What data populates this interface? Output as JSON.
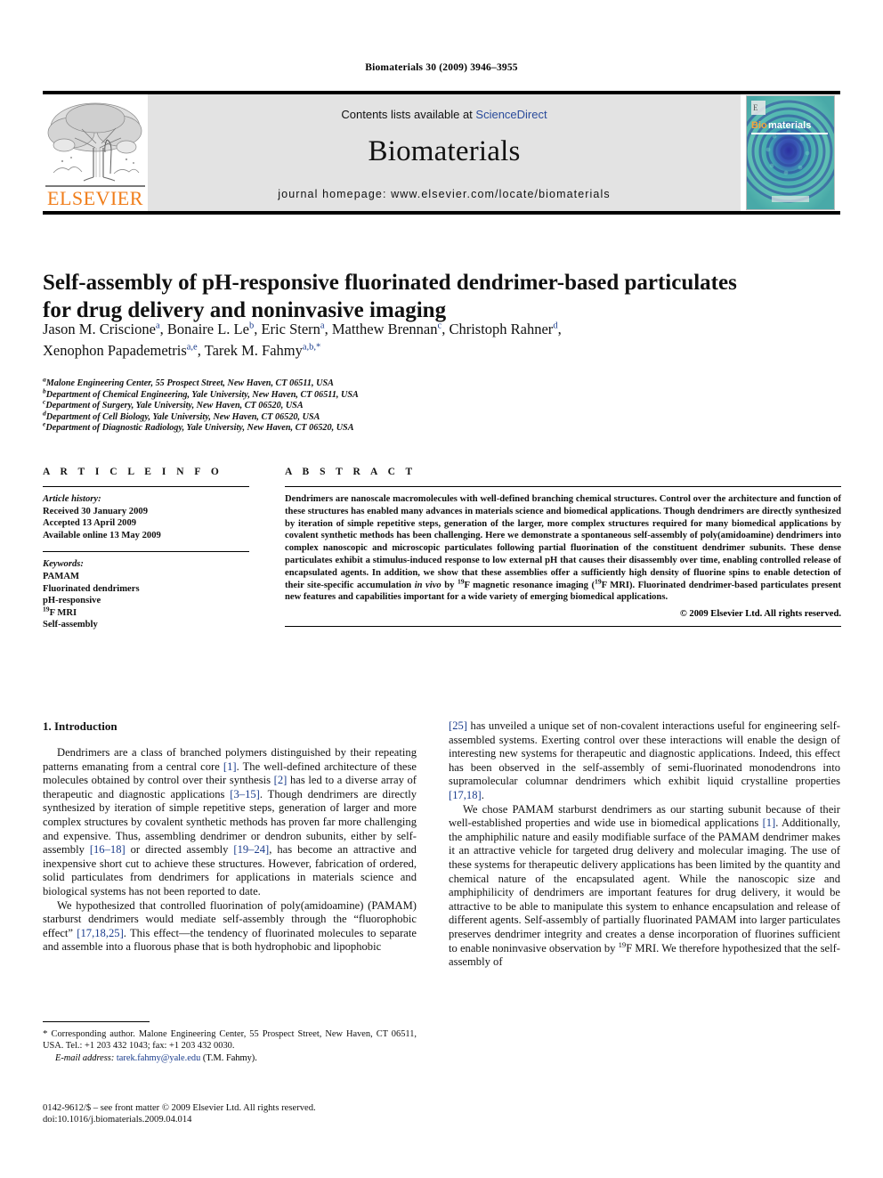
{
  "running_head": "Biomaterials 30 (2009) 3946–3955",
  "masthead": {
    "publisher_name": "ELSEVIER",
    "contents_prefix": "Contents lists available at ",
    "contents_link": "ScienceDirect",
    "journal_title": "Biomaterials",
    "homepage": "journal homepage: www.elsevier.com/locate/biomaterials",
    "cover_label": "Biomaterials",
    "link_color": "#2a4b9b",
    "brand_color": "#f07d1a",
    "band_color": "#e3e3e3"
  },
  "article": {
    "title_line1": "Self-assembly of pH-responsive fluorinated dendrimer-based particulates",
    "title_line2": "for drug delivery and noninvasive imaging",
    "authors": [
      {
        "name": "Jason M. Criscione",
        "sup": "a",
        "sep": ", "
      },
      {
        "name": "Bonaire L. Le",
        "sup": "b",
        "sep": ", "
      },
      {
        "name": "Eric Stern",
        "sup": "a",
        "sep": ", "
      },
      {
        "name": "Matthew Brennan",
        "sup": "c",
        "sep": ", "
      },
      {
        "name": "Christoph Rahner",
        "sup": "d",
        "sep": ","
      },
      {
        "name": "Xenophon Papademetris",
        "sup": "a,e",
        "sep": ", "
      },
      {
        "name": "Tarek M. Fahmy",
        "sup": "a,b,*",
        "sep": ""
      }
    ],
    "affiliations": [
      {
        "mark": "a",
        "text": "Malone Engineering Center, 55 Prospect Street, New Haven, CT 06511, USA"
      },
      {
        "mark": "b",
        "text": "Department of Chemical Engineering, Yale University, New Haven, CT 06511, USA"
      },
      {
        "mark": "c",
        "text": "Department of Surgery, Yale University, New Haven, CT 06520, USA"
      },
      {
        "mark": "d",
        "text": "Department of Cell Biology, Yale University, New Haven, CT 06520, USA"
      },
      {
        "mark": "e",
        "text": "Department of Diagnostic Radiology, Yale University, New Haven, CT 06520, USA"
      }
    ]
  },
  "article_info": {
    "heading": "A R T I C L E  I N F O",
    "history_label": "Article history:",
    "history": [
      "Received 30 January 2009",
      "Accepted 13 April 2009",
      "Available online 13 May 2009"
    ],
    "keywords_label": "Keywords:",
    "keywords": [
      "PAMAM",
      "Fluorinated dendrimers",
      "pH-responsive",
      "19F MRI",
      "Self-assembly"
    ]
  },
  "abstract": {
    "heading": "A B S T R A C T",
    "paragraph_part1": "Dendrimers are nanoscale macromolecules with well-defined branching chemical structures. Control over the architecture and function of these structures has enabled many advances in materials science and biomedical applications. Though dendrimers are directly synthesized by iteration of simple repetitive steps, generation of the larger, more complex structures required for many biomedical applications by covalent synthetic methods has been challenging. Here we demonstrate a spontaneous self-assembly of poly(amidoamine) dendrimers into complex nanoscopic and microscopic particulates following partial fluorination of the constituent dendrimer subunits. These dense particulates exhibit a stimulus-induced response to low external pH that causes their disassembly over time, enabling controlled release of encapsulated agents. In addition, we show that these assemblies offer a sufficiently high density of fluorine spins to enable detection of their site-specific accumulation ",
    "italic_in_vivo": "in vivo",
    "paragraph_part2": " by ",
    "sup1": "19",
    "paragraph_part3": "F magnetic resonance imaging (",
    "sup2": "19",
    "paragraph_part4": "F MRI). Fluorinated dendrimer-based particulates present new features and capabilities important for a wide variety of emerging biomedical applications.",
    "copyright": "© 2009 Elsevier Ltd. All rights reserved."
  },
  "introduction": {
    "section_title": "1. Introduction",
    "p1_a": "Dendrimers are a class of branched polymers distinguished by their repeating patterns emanating from a central core ",
    "p1_r1": "[1]",
    "p1_b": ". The well-defined architecture of these molecules obtained by control over their synthesis ",
    "p1_r2": "[2]",
    "p1_c": " has led to a diverse array of therapeutic and diagnostic applications ",
    "p1_r3": "[3–15]",
    "p1_d": ". Though dendrimers are directly synthesized by iteration of simple repetitive steps, generation of larger and more complex structures by covalent synthetic methods has proven far more challenging and expensive. Thus, assembling dendrimer or dendron subunits, either by self-assembly ",
    "p1_r4": "[16–18]",
    "p1_e": " or directed assembly ",
    "p1_r5": "[19–24]",
    "p1_f": ", has become an attractive and inexpensive short cut to achieve these structures. However, fabrication of ordered, solid particulates from dendrimers for applications in materials science and biological systems has not been reported to date.",
    "p2_a": "We hypothesized that controlled fluorination of poly(amidoamine) (PAMAM) starburst dendrimers would mediate self-assembly through the “fluorophobic effect” ",
    "p2_r1": "[17,18,25]",
    "p2_b": ". This effect—the tendency of fluorinated molecules to separate and assemble into a fluorous phase that is both hydrophobic and lipophobic ",
    "p2_r2": "[25]",
    "p2_c": " has unveiled a unique set of non-covalent interactions useful for engineering self-assembled systems. Exerting control over these interactions will enable the design of interesting new systems for therapeutic and diagnostic applications. Indeed, this effect has been observed in the self-assembly of semi-fluorinated monodendrons into supramolecular columnar dendrimers which exhibit liquid crystalline properties ",
    "p2_r3": "[17,18]",
    "p2_d": ".",
    "p3_a": "We chose PAMAM starburst dendrimers as our starting subunit because of their well-established properties and wide use in biomedical applications ",
    "p3_r1": "[1]",
    "p3_b": ". Additionally, the amphiphilic nature and easily modifiable surface of the PAMAM dendrimer makes it an attractive vehicle for targeted drug delivery and molecular imaging. The use of these systems for therapeutic delivery applications has been limited by the quantity and chemical nature of the encapsulated agent. While the nanoscopic size and amphiphilicity of dendrimers are important features for drug delivery, it would be attractive to be able to manipulate this system to enhance encapsulation and release of different agents. Self-assembly of partially fluorinated PAMAM into larger particulates preserves dendrimer integrity and creates a dense incorporation of fluorines sufficient to enable noninvasive observation by ",
    "p3_sup": "19",
    "p3_c": "F MRI. We therefore hypothesized that the self-assembly of"
  },
  "footnote": {
    "star": "*",
    "text": " Corresponding author. Malone Engineering Center, 55 Prospect Street, New Haven, CT 06511, USA. Tel.: +1 203 432 1043; fax: +1 203 432 0030.",
    "email_label": "E-mail address:",
    "email": "tarek.fahmy@yale.edu",
    "email_owner": " (T.M. Fahmy)."
  },
  "imprint": {
    "line1": "0142-9612/$ – see front matter © 2009 Elsevier Ltd. All rights reserved.",
    "line2": "doi:10.1016/j.biomaterials.2009.04.014"
  }
}
